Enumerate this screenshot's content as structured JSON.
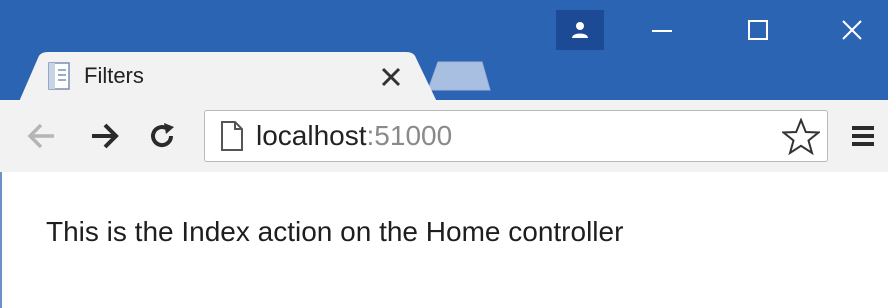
{
  "tab": {
    "title": "Filters",
    "favicon": "page-favicon-icon",
    "close_icon": "close-icon"
  },
  "window_controls": {
    "profile_icon": "user-icon",
    "minimize_icon": "minimize-icon",
    "maximize_icon": "maximize-icon",
    "close_icon": "close-icon"
  },
  "toolbar": {
    "back_icon": "arrow-left-icon",
    "forward_icon": "arrow-right-icon",
    "reload_icon": "reload-icon",
    "page_icon": "page-icon",
    "url_host": "localhost",
    "url_port": ":51000",
    "bookmark_icon": "star-icon",
    "menu_icon": "hamburger-menu-icon"
  },
  "page": {
    "text": "This is the Index action on the Home controller"
  },
  "colors": {
    "titlebar": "#2c64b4",
    "profile_button": "#1c4a95",
    "toolbar": "#f2f2f2",
    "inactive_tab": "#a9bfe2"
  }
}
